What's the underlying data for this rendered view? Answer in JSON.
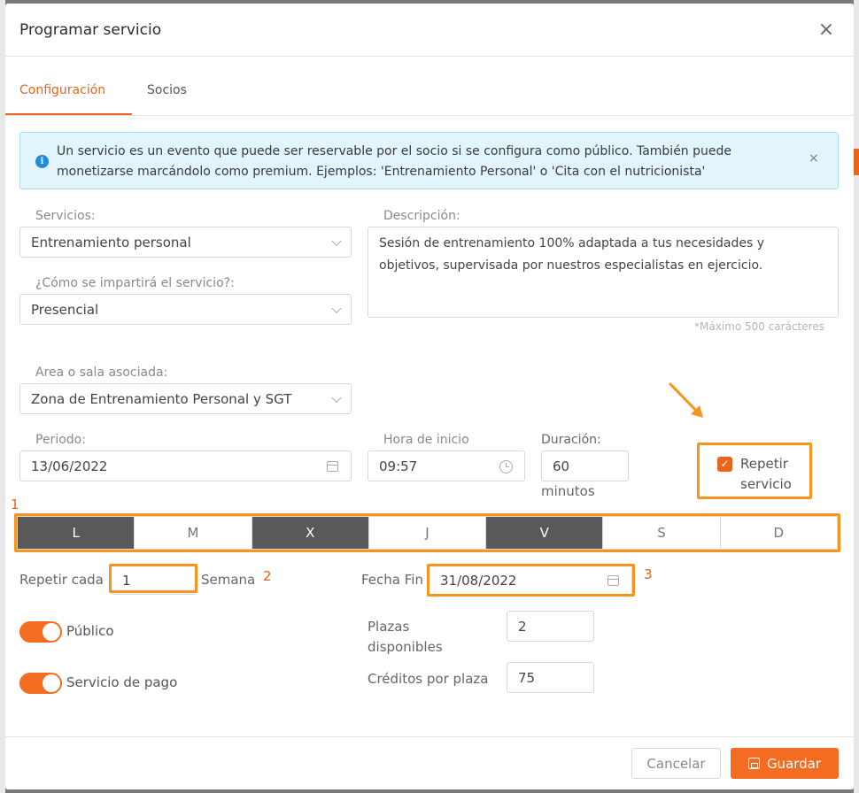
{
  "modal": {
    "title": "Programar servicio",
    "close_icon": "close-icon"
  },
  "tabs": [
    {
      "label": "Configuración",
      "active": true
    },
    {
      "label": "Socios",
      "active": false
    }
  ],
  "alert": {
    "icon": "info-icon",
    "text": "Un servicio es un evento que puede ser reservable por el socio si se configura como público. También puede monetizarse marcándolo como premium. Ejemplos: 'Entrenamiento Personal' o 'Cita con el nutricionista'",
    "close": "×"
  },
  "form": {
    "servicios": {
      "label": "Servicios:",
      "value": "Entrenamiento personal"
    },
    "imparticion": {
      "label": "¿Cómo se impartirá el servicio?:",
      "value": "Presencial"
    },
    "descripcion": {
      "label": "Descripción:",
      "value": "Sesión de entrenamiento 100% adaptada a tus necesidades y objetivos, supervisada por nuestros especialistas en ejercicio.",
      "hint": "*Máximo 500 carácteres"
    },
    "area": {
      "label": "Area o sala asociada:",
      "value": "Zona de Entrenamiento Personal y SGT"
    },
    "periodo": {
      "label": "Periodo:",
      "value": "13/06/2022"
    },
    "hora_inicio": {
      "label": "Hora de inicio",
      "value": "09:57"
    },
    "duracion": {
      "label": "Duración:",
      "value": "60",
      "unit": "minutos"
    },
    "repetir": {
      "label_line1": "Repetir",
      "label_line2": "servicio",
      "checked": true
    },
    "days": [
      {
        "label": "L",
        "selected": true
      },
      {
        "label": "M",
        "selected": false
      },
      {
        "label": "X",
        "selected": true
      },
      {
        "label": "J",
        "selected": false
      },
      {
        "label": "V",
        "selected": true
      },
      {
        "label": "S",
        "selected": false
      },
      {
        "label": "D",
        "selected": false
      }
    ],
    "repetir_cada": {
      "label": "Repetir cada",
      "value": "1",
      "unit": "Semana"
    },
    "fecha_fin": {
      "label": "Fecha Fin",
      "value": "31/08/2022"
    },
    "publico": {
      "label": "Público",
      "on": true
    },
    "servicio_pago": {
      "label": "Servicio de pago",
      "on": true
    },
    "plazas": {
      "label_line1": "Plazas",
      "label_line2": "disponibles",
      "value": "2"
    },
    "creditos": {
      "label": "Créditos por plaza",
      "value": "75"
    }
  },
  "annotations": {
    "n1": "1",
    "n2": "2",
    "n3": "3",
    "highlight_color": "#f7941d"
  },
  "footer": {
    "cancel": "Cancelar",
    "save": "Guardar"
  },
  "colors": {
    "accent": "#f36c21",
    "day_selected": "#595959",
    "alert_bg": "#e3f5fc"
  }
}
